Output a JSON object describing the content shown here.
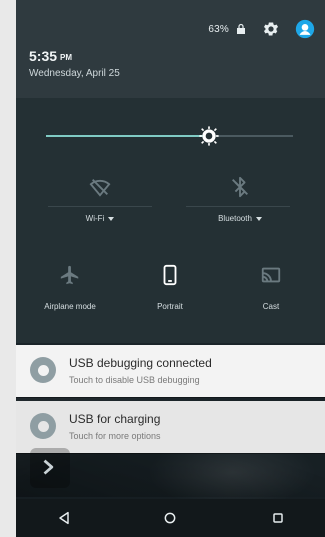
{
  "status": {
    "battery_percent": "63%",
    "time": "5:35",
    "ampm": "PM",
    "date": "Wednesday, April 25"
  },
  "quick_settings": {
    "brightness_level": 0.66,
    "tiles": {
      "wifi": {
        "label": "Wi-Fi",
        "icon": "wifi-off-icon"
      },
      "bluetooth": {
        "label": "Bluetooth",
        "icon": "bluetooth-off-icon"
      },
      "airplane": {
        "label": "Airplane mode",
        "icon": "airplane-icon"
      },
      "rotation": {
        "label": "Portrait",
        "icon": "portrait-icon"
      },
      "cast": {
        "label": "Cast",
        "icon": "cast-icon"
      }
    }
  },
  "notifications": [
    {
      "title": "USB debugging connected",
      "subtitle": "Touch to disable USB debugging"
    },
    {
      "title": "USB for charging",
      "subtitle": "Touch for more options"
    }
  ],
  "colors": {
    "accent": "#80cbc4",
    "account_avatar": "#1ea7e8"
  }
}
